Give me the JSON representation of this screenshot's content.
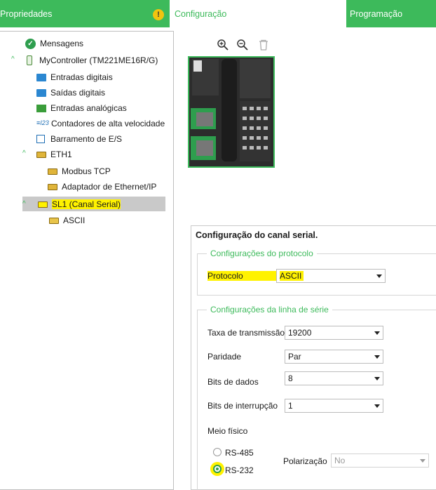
{
  "tabs": {
    "properties": "Propriedades",
    "configuration": "Configuração",
    "programming": "Programação",
    "warning_icon": "!"
  },
  "tree": {
    "messages": "Mensagens",
    "controller": "MyController (TM221ME16R/G)",
    "digital_inputs": "Entradas digitais",
    "digital_outputs": "Saídas digitais",
    "analog_inputs": "Entradas analógicas",
    "hs_counters": "Contadores de alta velocidade",
    "counter_icon_text": "≡I23",
    "io_bus": "Barramento de E/S",
    "eth1": "ETH1",
    "modbus_tcp": "Modbus TCP",
    "ethernet_ip": "Adaptador de Ethernet/IP",
    "sl1": "SL1 (Canal Serial)",
    "ascii": "ASCII"
  },
  "toolbar": {
    "zoom_in_icon": "zoom-in",
    "zoom_out_icon": "zoom-out",
    "delete_icon": "trash"
  },
  "config": {
    "title": "Configuração do canal serial.",
    "protocol_group": "Configurações do protocolo",
    "protocol_label": "Protocolo",
    "protocol_value": "ASCII",
    "serial_group": "Configurações da linha de série",
    "baud_label": "Taxa de transmissão",
    "baud_value": "19200",
    "parity_label": "Paridade",
    "parity_value": "Par",
    "data_bits_label": "Bits de dados",
    "data_bits_value": "8",
    "stop_bits_label": "Bits de interrupção",
    "stop_bits_value": "1",
    "physical_label": "Meio físico",
    "rs485_label": "RS-485",
    "rs232_label": "RS-232",
    "polarization_label": "Polarização",
    "polarization_value": "No",
    "selected_physical": "RS-232"
  },
  "colors": {
    "accent": "#3dba5b",
    "highlight": "#fff200",
    "selection": "#c9c9c9"
  }
}
